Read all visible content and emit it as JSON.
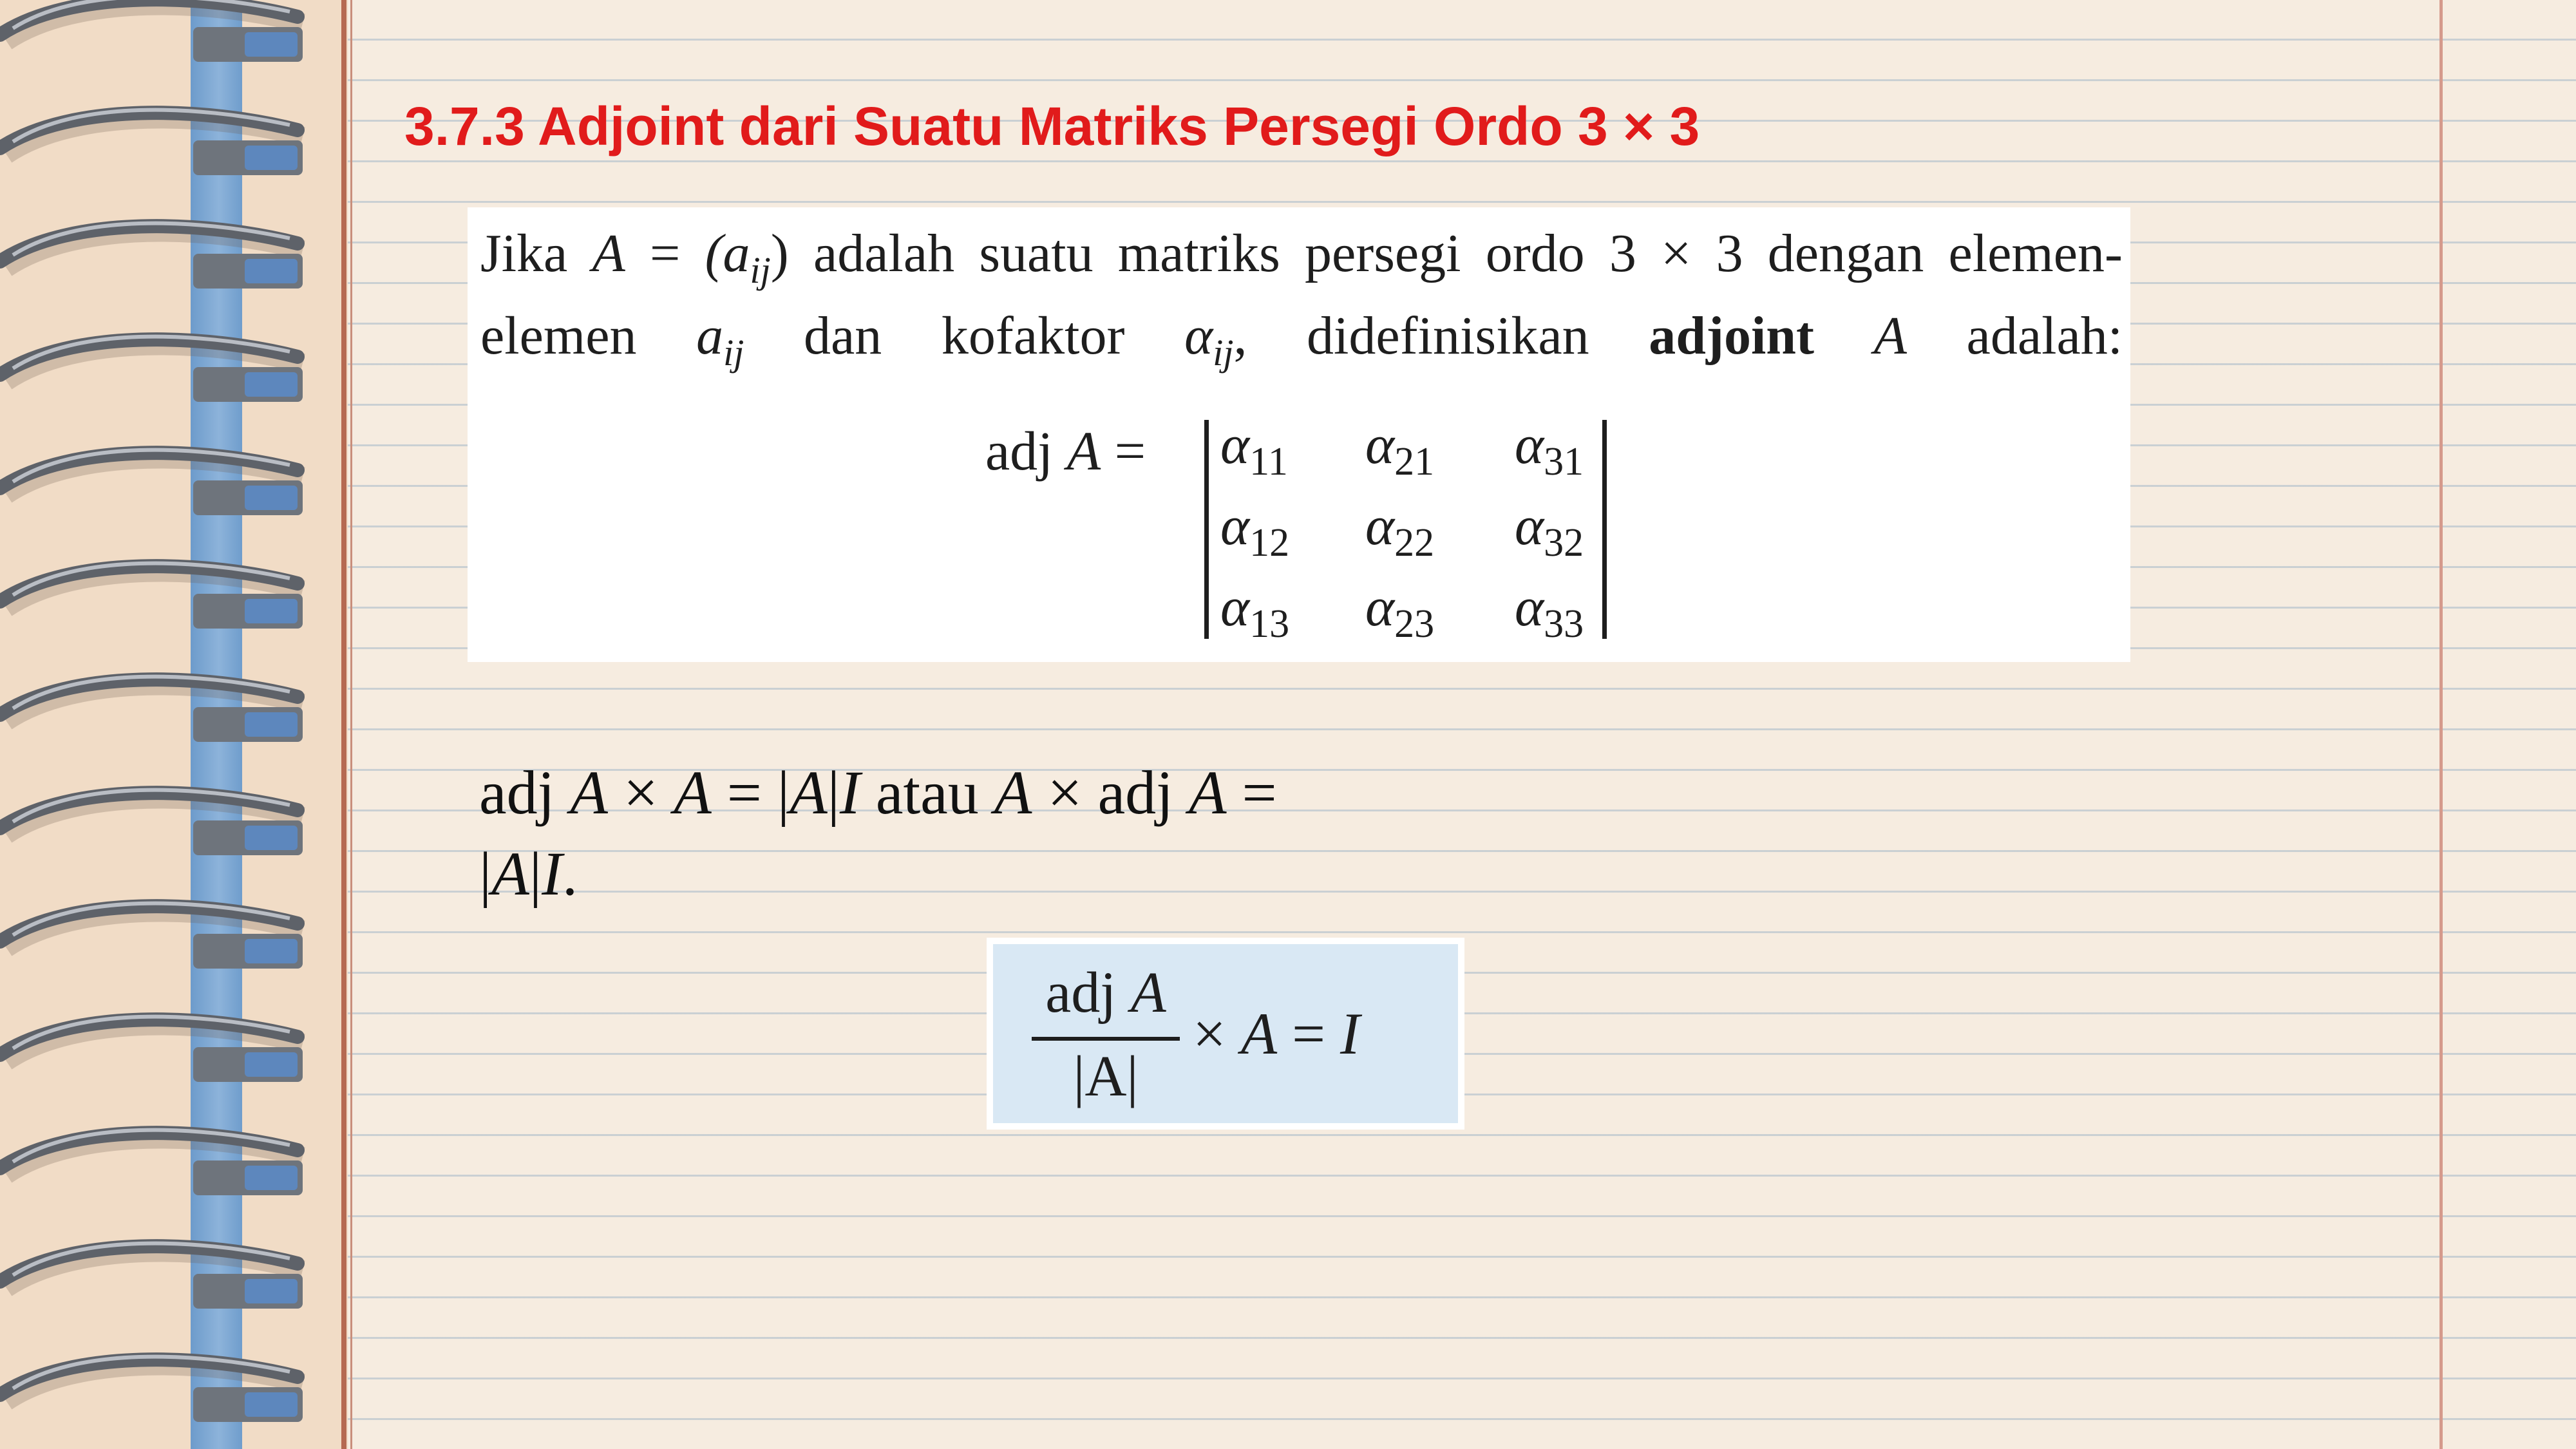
{
  "section": {
    "title": "3.7.3 Adjoint dari Suatu Matriks Persegi Ordo 3 × 3"
  },
  "definition": {
    "line1": {
      "w1": "Jika",
      "A": "A",
      "eq": "=",
      "open": "(a",
      "sub": "ij",
      "close": ")",
      "rest": "adalah suatu matriks persegi ordo 3 × 3 dengan"
    },
    "line2": {
      "start": "elemen-elemen",
      "a": "a",
      "a_sub": "ij",
      "mid": "dan kofaktor",
      "alpha": "α",
      "alpha_sub": "ij",
      "comma": ", didefinisikan",
      "bold": "adjoint",
      "A": "A",
      "end": "adalah:"
    },
    "adj_label": "adj",
    "adj_A": "A",
    "adj_eq": "=",
    "matrix": [
      [
        {
          "g": "α",
          "s": "11"
        },
        {
          "g": "α",
          "s": "21"
        },
        {
          "g": "α",
          "s": "31"
        }
      ],
      [
        {
          "g": "α",
          "s": "12"
        },
        {
          "g": "α",
          "s": "22"
        },
        {
          "g": "α",
          "s": "32"
        }
      ],
      [
        {
          "g": "α",
          "s": "13"
        },
        {
          "g": "α",
          "s": "23"
        },
        {
          "g": "α",
          "s": "33"
        }
      ]
    ]
  },
  "property": {
    "p1": "adj",
    "p2": "A",
    "p3": "×",
    "p4": "A",
    "p5": "= |",
    "p6": "A",
    "p7": "|",
    "p8": "I",
    "p9": "atau",
    "p10": "A",
    "p11": "× adj",
    "p12": "A",
    "p13": "=",
    "p14": "|",
    "p15": "A",
    "p16": "|",
    "p17": "I",
    "p18": "."
  },
  "formula": {
    "num_adj": "adj",
    "num_A": "A",
    "den": "|A|",
    "times": "×",
    "A": "A",
    "eq": "=",
    "I": "I"
  }
}
